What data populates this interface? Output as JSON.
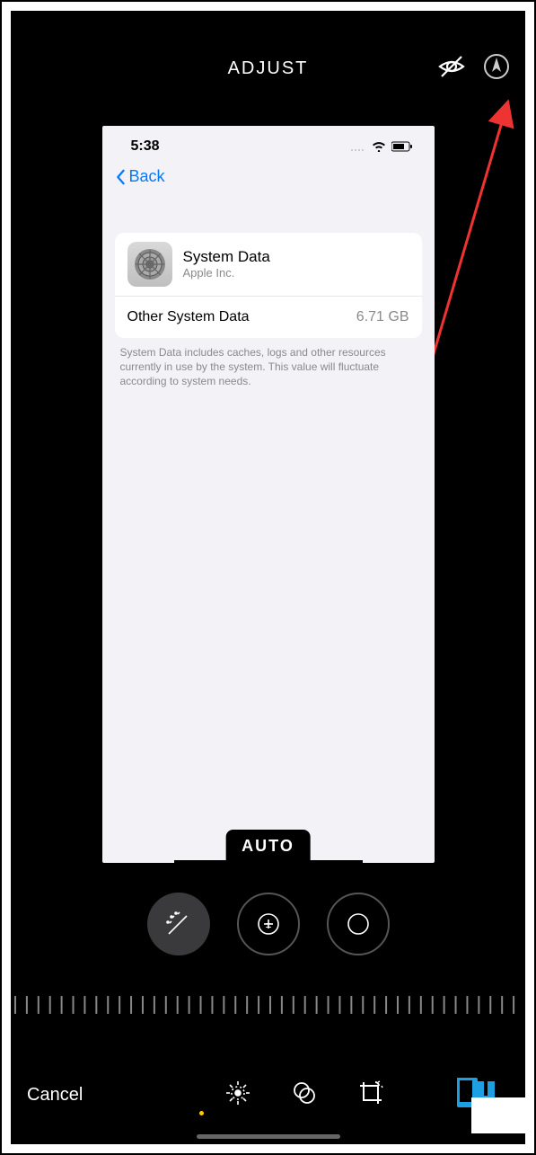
{
  "topbar": {
    "title": "ADJUST",
    "cancel_label": "Cancel"
  },
  "auto_label": "AUTO",
  "inner_screenshot": {
    "status_time": "5:38",
    "back_label": "Back",
    "app_title": "System Data",
    "app_subtitle": "Apple Inc.",
    "row_label": "Other System Data",
    "row_value": "6.71 GB",
    "footnote": "System Data includes caches, logs and other resources currently in use by the system. This value will fluctuate according to system needs."
  }
}
